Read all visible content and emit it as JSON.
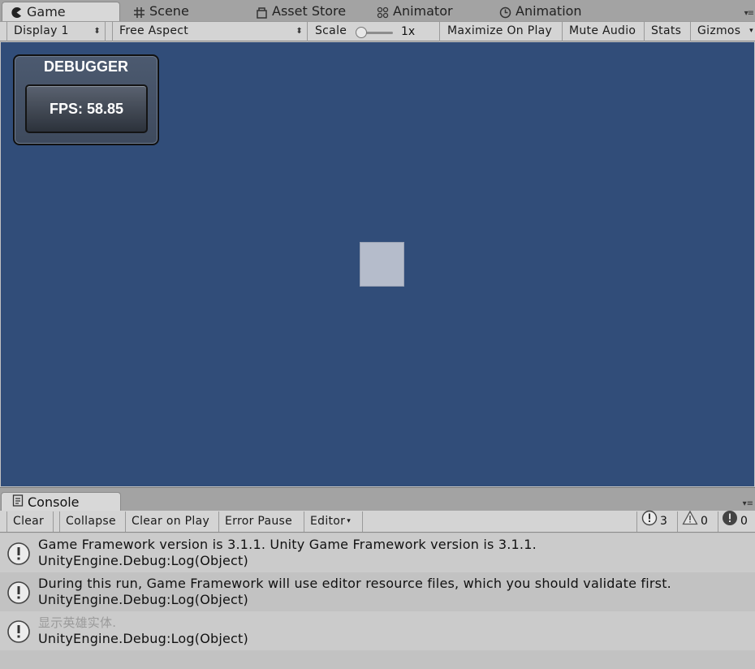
{
  "tabs": [
    {
      "label": "Game",
      "icon": "pacman-icon"
    },
    {
      "label": "Scene",
      "icon": "grid-icon"
    },
    {
      "label": "Asset Store",
      "icon": "store-icon"
    },
    {
      "label": "Animator",
      "icon": "animator-icon"
    },
    {
      "label": "Animation",
      "icon": "clock-icon"
    }
  ],
  "game_toolbar": {
    "display": "Display 1",
    "aspect": "Free Aspect",
    "scale_label": "Scale",
    "scale_value": "1x",
    "maximize": "Maximize On Play",
    "mute": "Mute Audio",
    "stats": "Stats",
    "gizmos": "Gizmos"
  },
  "debugger": {
    "title": "DEBUGGER",
    "fps": "FPS: 58.85"
  },
  "console": {
    "tab_label": "Console",
    "toolbar": {
      "clear": "Clear",
      "collapse": "Collapse",
      "clear_on_play": "Clear on Play",
      "error_pause": "Error Pause",
      "editor": "Editor"
    },
    "counts": {
      "info": "3",
      "warnings": "0",
      "errors": "0"
    },
    "entries": [
      {
        "message": "Game Framework version is 3.1.1. Unity Game Framework version is 3.1.1.",
        "trace": "UnityEngine.Debug:Log(Object)"
      },
      {
        "message": "During this run, Game Framework will use editor resource files, which you should validate first.",
        "trace": "UnityEngine.Debug:Log(Object)"
      },
      {
        "message": "显示英雄实体.",
        "trace": "UnityEngine.Debug:Log(Object)"
      }
    ]
  },
  "colors": {
    "viewport_bg": "#314d79",
    "cube": "#b5bccb",
    "panel_bg": "#c2c2c2"
  }
}
